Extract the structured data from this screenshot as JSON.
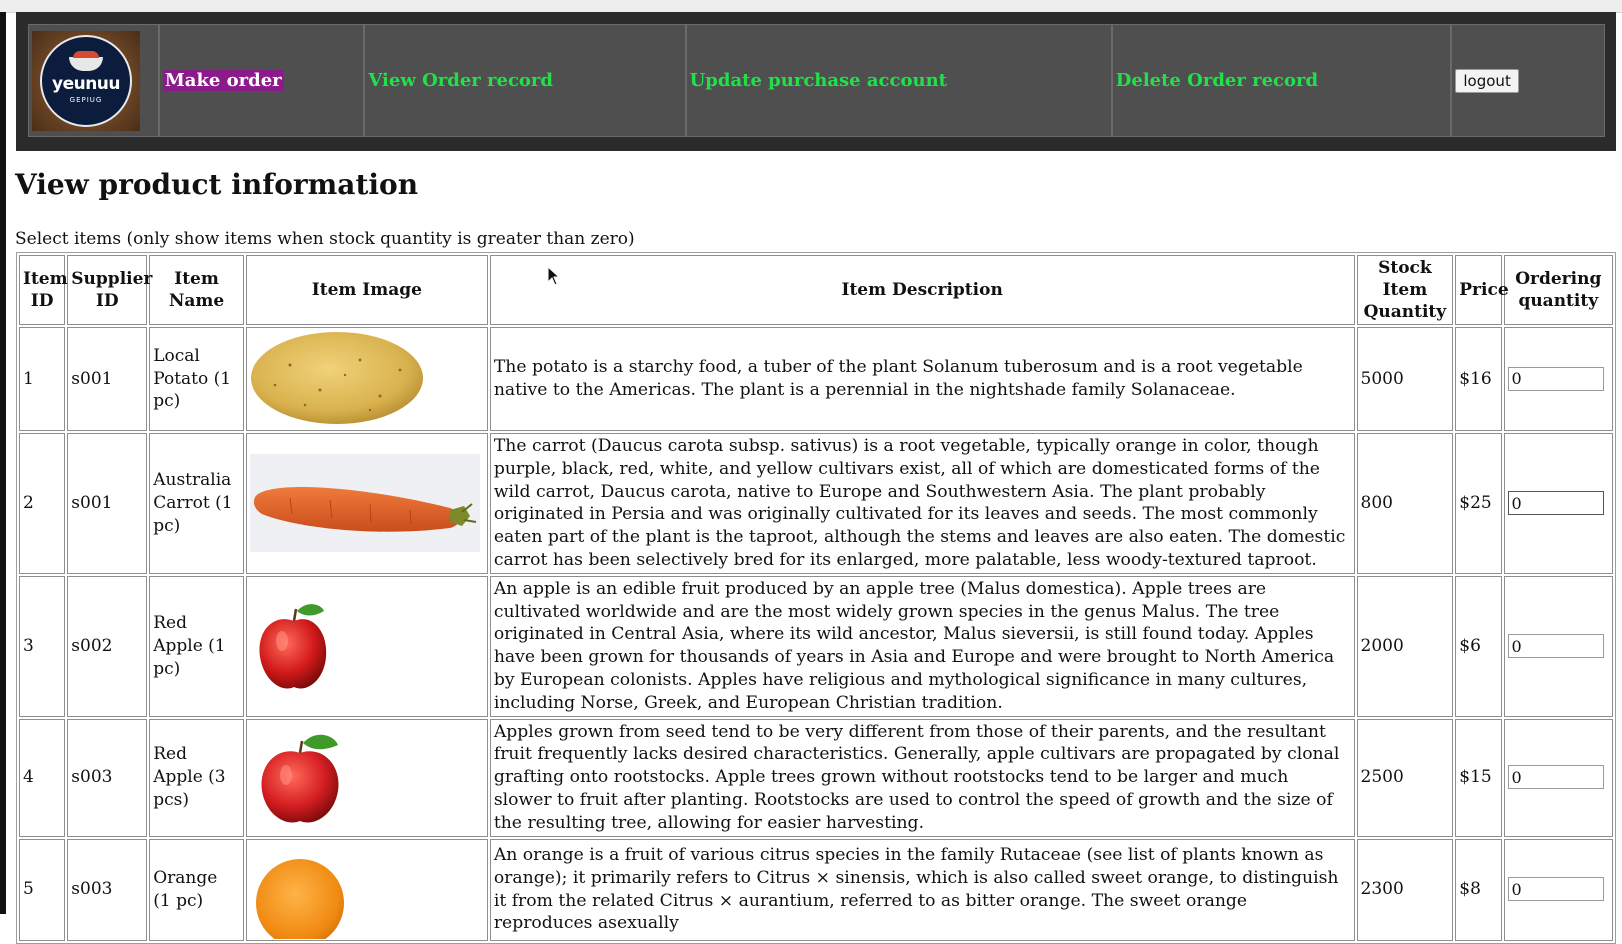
{
  "nav": {
    "logo_text": "yeunuu",
    "logo_subtext": "GEPIUG",
    "links": [
      {
        "label": "Make order",
        "active": true
      },
      {
        "label": "View Order record",
        "active": false
      },
      {
        "label": "Update purchase account",
        "active": false
      },
      {
        "label": "Delete Order record",
        "active": false
      }
    ],
    "logout_label": "logout"
  },
  "page": {
    "title": "View product information",
    "subtitle": "Select items (only show items when stock quantity is greater than zero)"
  },
  "table": {
    "headers": {
      "item_id": "Item ID",
      "supplier_id": "Supplier ID",
      "item_name": "Item Name",
      "item_image": "Item Image",
      "item_description": "Item Description",
      "stock_quantity": "Stock Item Quantity",
      "price": "Price",
      "ordering_quantity": "Ordering quantity"
    },
    "rows": [
      {
        "item_id": "1",
        "supplier_id": "s001",
        "item_name": "Local Potato (1 pc)",
        "image": "potato-image",
        "description": "The potato is a starchy food, a tuber of the plant Solanum tuberosum and is a root vegetable native to the Americas. The plant is a perennial in the nightshade family Solanaceae.",
        "stock": "5000",
        "price": "$16",
        "order_qty": "0"
      },
      {
        "item_id": "2",
        "supplier_id": "s001",
        "item_name": "Australia Carrot (1 pc)",
        "image": "carrot-image",
        "description": "The carrot (Daucus carota subsp. sativus) is a root vegetable, typically orange in color, though purple, black, red, white, and yellow cultivars exist, all of which are domesticated forms of the wild carrot, Daucus carota, native to Europe and Southwestern Asia. The plant probably originated in Persia and was originally cultivated for its leaves and seeds. The most commonly eaten part of the plant is the taproot, although the stems and leaves are also eaten. The domestic carrot has been selectively bred for its enlarged, more palatable, less woody-textured taproot.",
        "stock": "800",
        "price": "$25",
        "order_qty": "0"
      },
      {
        "item_id": "3",
        "supplier_id": "s002",
        "item_name": "Red Apple (1 pc)",
        "image": "apple-image",
        "description": "An apple is an edible fruit produced by an apple tree (Malus domestica). Apple trees are cultivated worldwide and are the most widely grown species in the genus Malus. The tree originated in Central Asia, where its wild ancestor, Malus sieversii, is still found today. Apples have been grown for thousands of years in Asia and Europe and were brought to North America by European colonists. Apples have religious and mythological significance in many cultures, including Norse, Greek, and European Christian tradition.",
        "stock": "2000",
        "price": "$6",
        "order_qty": "0"
      },
      {
        "item_id": "4",
        "supplier_id": "s003",
        "item_name": "Red Apple (3 pcs)",
        "image": "apple-image",
        "description": "Apples grown from seed tend to be very different from those of their parents, and the resultant fruit frequently lacks desired characteristics. Generally, apple cultivars are propagated by clonal grafting onto rootstocks. Apple trees grown without rootstocks tend to be larger and much slower to fruit after planting. Rootstocks are used to control the speed of growth and the size of the resulting tree, allowing for easier harvesting.",
        "stock": "2500",
        "price": "$15",
        "order_qty": "0"
      },
      {
        "item_id": "5",
        "supplier_id": "s003",
        "item_name": "Orange (1 pc)",
        "image": "orange-image",
        "description": "An orange is a fruit of various citrus species in the family Rutaceae (see list of plants known as orange); it primarily refers to Citrus × sinensis, which is also called sweet orange, to distinguish it from the related Citrus × aurantium, referred to as bitter orange. The sweet orange reproduces asexually",
        "stock": "2300",
        "price": "$8",
        "order_qty": "0"
      }
    ]
  }
}
